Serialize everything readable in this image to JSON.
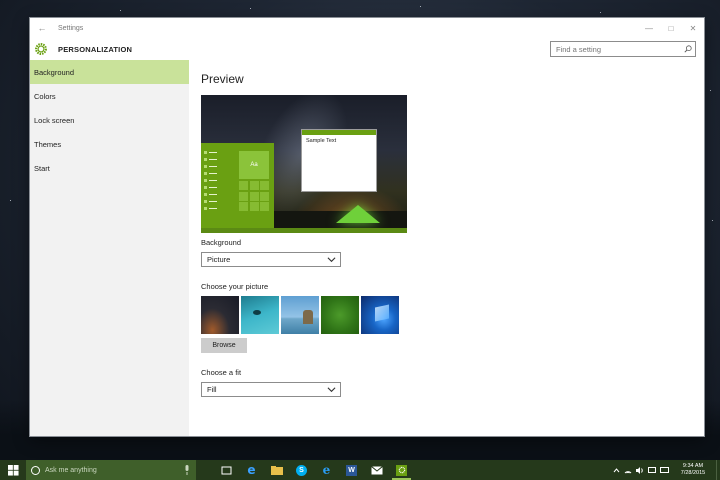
{
  "window": {
    "title": "Settings",
    "app_name": "PERSONALIZATION",
    "search_placeholder": "Find a setting"
  },
  "sidebar": {
    "items": [
      {
        "label": "Background",
        "active": true
      },
      {
        "label": "Colors",
        "active": false
      },
      {
        "label": "Lock screen",
        "active": false
      },
      {
        "label": "Themes",
        "active": false
      },
      {
        "label": "Start",
        "active": false
      }
    ]
  },
  "main": {
    "preview_heading": "Preview",
    "preview_sample_text": "Sample Text",
    "preview_tile_text": "Aa",
    "background_label": "Background",
    "background_value": "Picture",
    "choose_picture_label": "Choose your picture",
    "browse_label": "Browse",
    "choose_fit_label": "Choose a fit",
    "fit_value": "Fill"
  },
  "taskbar": {
    "search_placeholder": "Ask me anything",
    "time": "9:34 AM",
    "date": "7/28/2015"
  },
  "colors": {
    "accent": "#6aa012",
    "sidebar_active": "#c9e29a",
    "taskbar": "#25391b"
  }
}
